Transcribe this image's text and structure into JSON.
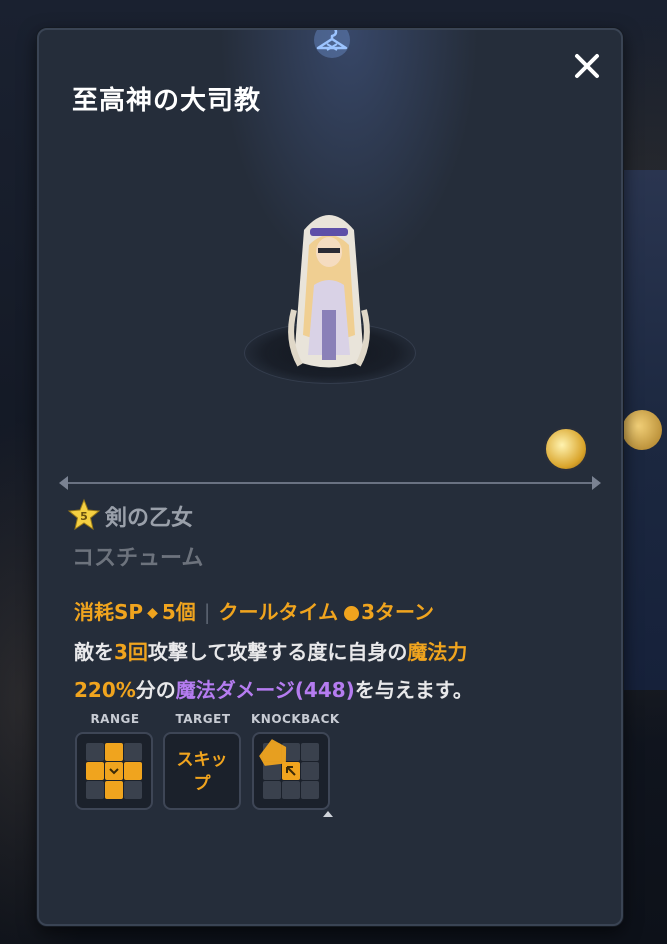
{
  "title": "至高神の大司教",
  "skill": {
    "rank": "5",
    "name": "剣の乙女",
    "type": "コスチューム"
  },
  "cost": {
    "sp_label": "消耗SP",
    "sp_value": "5個",
    "cooltime_label": "クールタイム",
    "cooltime_value": "3ターン"
  },
  "description": {
    "p1": "敵を",
    "hits": "3回",
    "p2": "攻撃して攻撃する度に自身の",
    "stat": "魔法力",
    "ratio": "220%",
    "p3": "分の",
    "damage": "魔法ダメージ(448)",
    "p4": "を与えます。"
  },
  "slots": {
    "range_label": "RANGE",
    "target_label": "TARGET",
    "target_value_1": "スキッ",
    "target_value_2": "プ",
    "knockback_label": "KNOCKBACK"
  },
  "colors": {
    "accent_orange": "#f0a41e",
    "damage_purple": "#b57cf0",
    "panel_bg": "#252d3a"
  },
  "icons": [
    "hanger-icon",
    "close-icon",
    "weapon-icon",
    "star-icon",
    "clock-icon"
  ]
}
